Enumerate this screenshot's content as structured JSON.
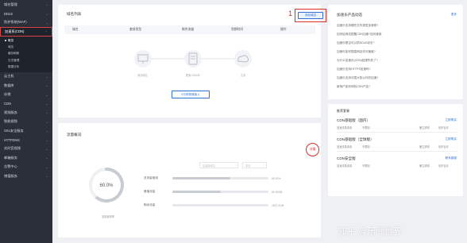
{
  "sidebar": {
    "items": [
      {
        "label": "域名管理"
      },
      {
        "label": "DDoS"
      },
      {
        "label": "防护系统(WAF)"
      },
      {
        "label": "加速系(CDN)"
      },
      {
        "label": "云主机"
      },
      {
        "label": "数据库"
      },
      {
        "label": "存储"
      },
      {
        "label": "CDN"
      },
      {
        "label": "视频服务"
      },
      {
        "label": "智能视频"
      },
      {
        "label": "SSL安全服务"
      },
      {
        "label": "HTTPDNS"
      },
      {
        "label": "实时音视频"
      },
      {
        "label": "邮箱服务"
      },
      {
        "label": "告警中心"
      },
      {
        "label": "增值服务"
      }
    ],
    "submenu": [
      {
        "label": "概览"
      },
      {
        "label": "域名"
      },
      {
        "label": "缓存刷新"
      },
      {
        "label": "日志管理"
      },
      {
        "label": "数据分析"
      }
    ]
  },
  "domain_panel": {
    "title": "域名列表",
    "add_button": "添加域名",
    "callout": "1",
    "columns": [
      "域名",
      "套餐类型",
      "剩余流量",
      "到期时间",
      "操作"
    ],
    "empty_labels": [
      "添加域名",
      "配置CNAME",
      "生效"
    ],
    "cta": "2分钟快速接入"
  },
  "usage_panel": {
    "title": "流量概况",
    "select1": "请选择域名",
    "select2": "本月",
    "badge": "详情",
    "ring_value": "60.0%",
    "ring_label": "流量使用率",
    "metrics": [
      {
        "label": "总流量使用",
        "value": "60.00%",
        "fill": 0.6
      },
      {
        "label": "峰值流量",
        "value": "50.00GB",
        "fill": 0.5
      },
      {
        "label": "剩余流量",
        "value": "1837.2GB",
        "fill": 0.0
      }
    ]
  },
  "news_panel": {
    "title": "加速乐产品动态",
    "more": "更多",
    "items": [
      "加速乐支持哪些文件类型加速呢?",
      "如何给网站配置CDN加速?如何使用",
      "加速乐是否可以防DDoS攻击?",
      "加速乐如何提高网站访问速度?",
      "为什么加速乐(CDN)回源失败了?",
      "加速乐支持HTTPS加速吗?",
      "加速乐支持中国大陆以外的加速?",
      "新用户如何体验CDN产品?"
    ]
  },
  "packages_panel": {
    "title": "推荐套餐",
    "packages": [
      {
        "name": "CDN基础版（国内）",
        "link": "立即购买",
        "meta": [
          "加速流量费用",
          "不限制",
          "备注说明",
          "包年包月"
        ]
      },
      {
        "name": "CDN基础版（全球版）",
        "link": "立即购买",
        "meta": [
          "加速流量费用",
          "不限制",
          "备注说明",
          "包年包月"
        ]
      },
      {
        "name": "CDN安全版",
        "link": "联系客服",
        "meta": [
          "加速流量费用",
          "不限制",
          "备注说明",
          "包年包月"
        ]
      }
    ]
  },
  "watermark": "知乎 @乐闻世界"
}
